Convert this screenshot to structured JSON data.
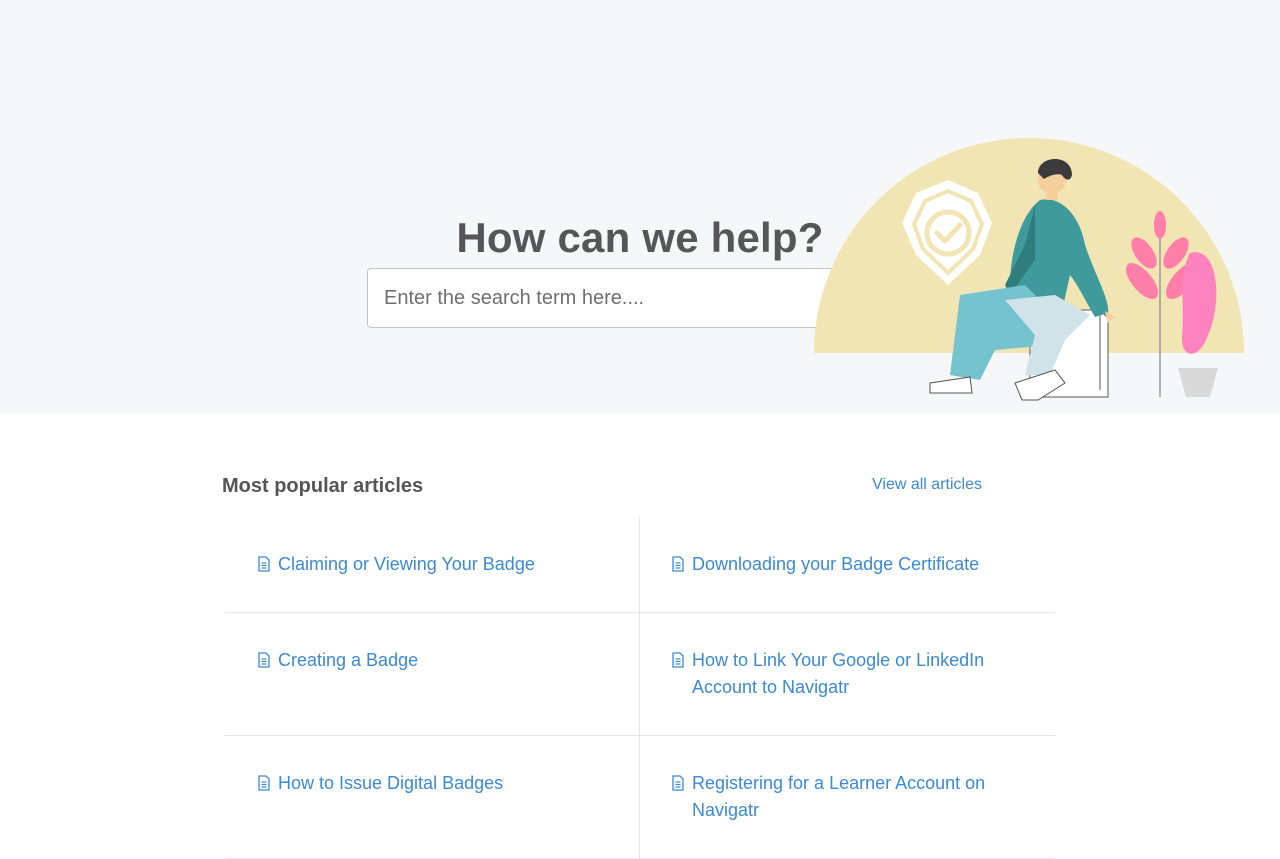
{
  "hero": {
    "title": "How can we help?",
    "search_placeholder": "Enter the search term here....",
    "illustration": "person-sitting-with-badge-and-plant",
    "colors": {
      "sun": "#f1e5b4",
      "badge": "#ffffff",
      "shirt": "#3f9b9b",
      "pants": "#74c3cf",
      "plant": "#ff7fa8",
      "pot": "#d9d9d9"
    }
  },
  "popular": {
    "title": "Most popular articles",
    "view_all_label": "View all articles",
    "articles": [
      {
        "label": "Claiming or Viewing Your Badge",
        "icon": "document-icon"
      },
      {
        "label": "Downloading your Badge Certificate",
        "icon": "document-icon"
      },
      {
        "label": "Creating a Badge",
        "icon": "document-icon"
      },
      {
        "label": "How to Link Your Google or LinkedIn Account to Navigatr",
        "icon": "document-icon"
      },
      {
        "label": "How to Issue Digital Badges",
        "icon": "document-icon"
      },
      {
        "label": "Registering for a Learner Account on Navigatr",
        "icon": "document-icon"
      }
    ]
  },
  "theme": {
    "link_color": "#3b8ad3",
    "heading_color": "#565656",
    "hero_bg": "#f5f7f9"
  }
}
